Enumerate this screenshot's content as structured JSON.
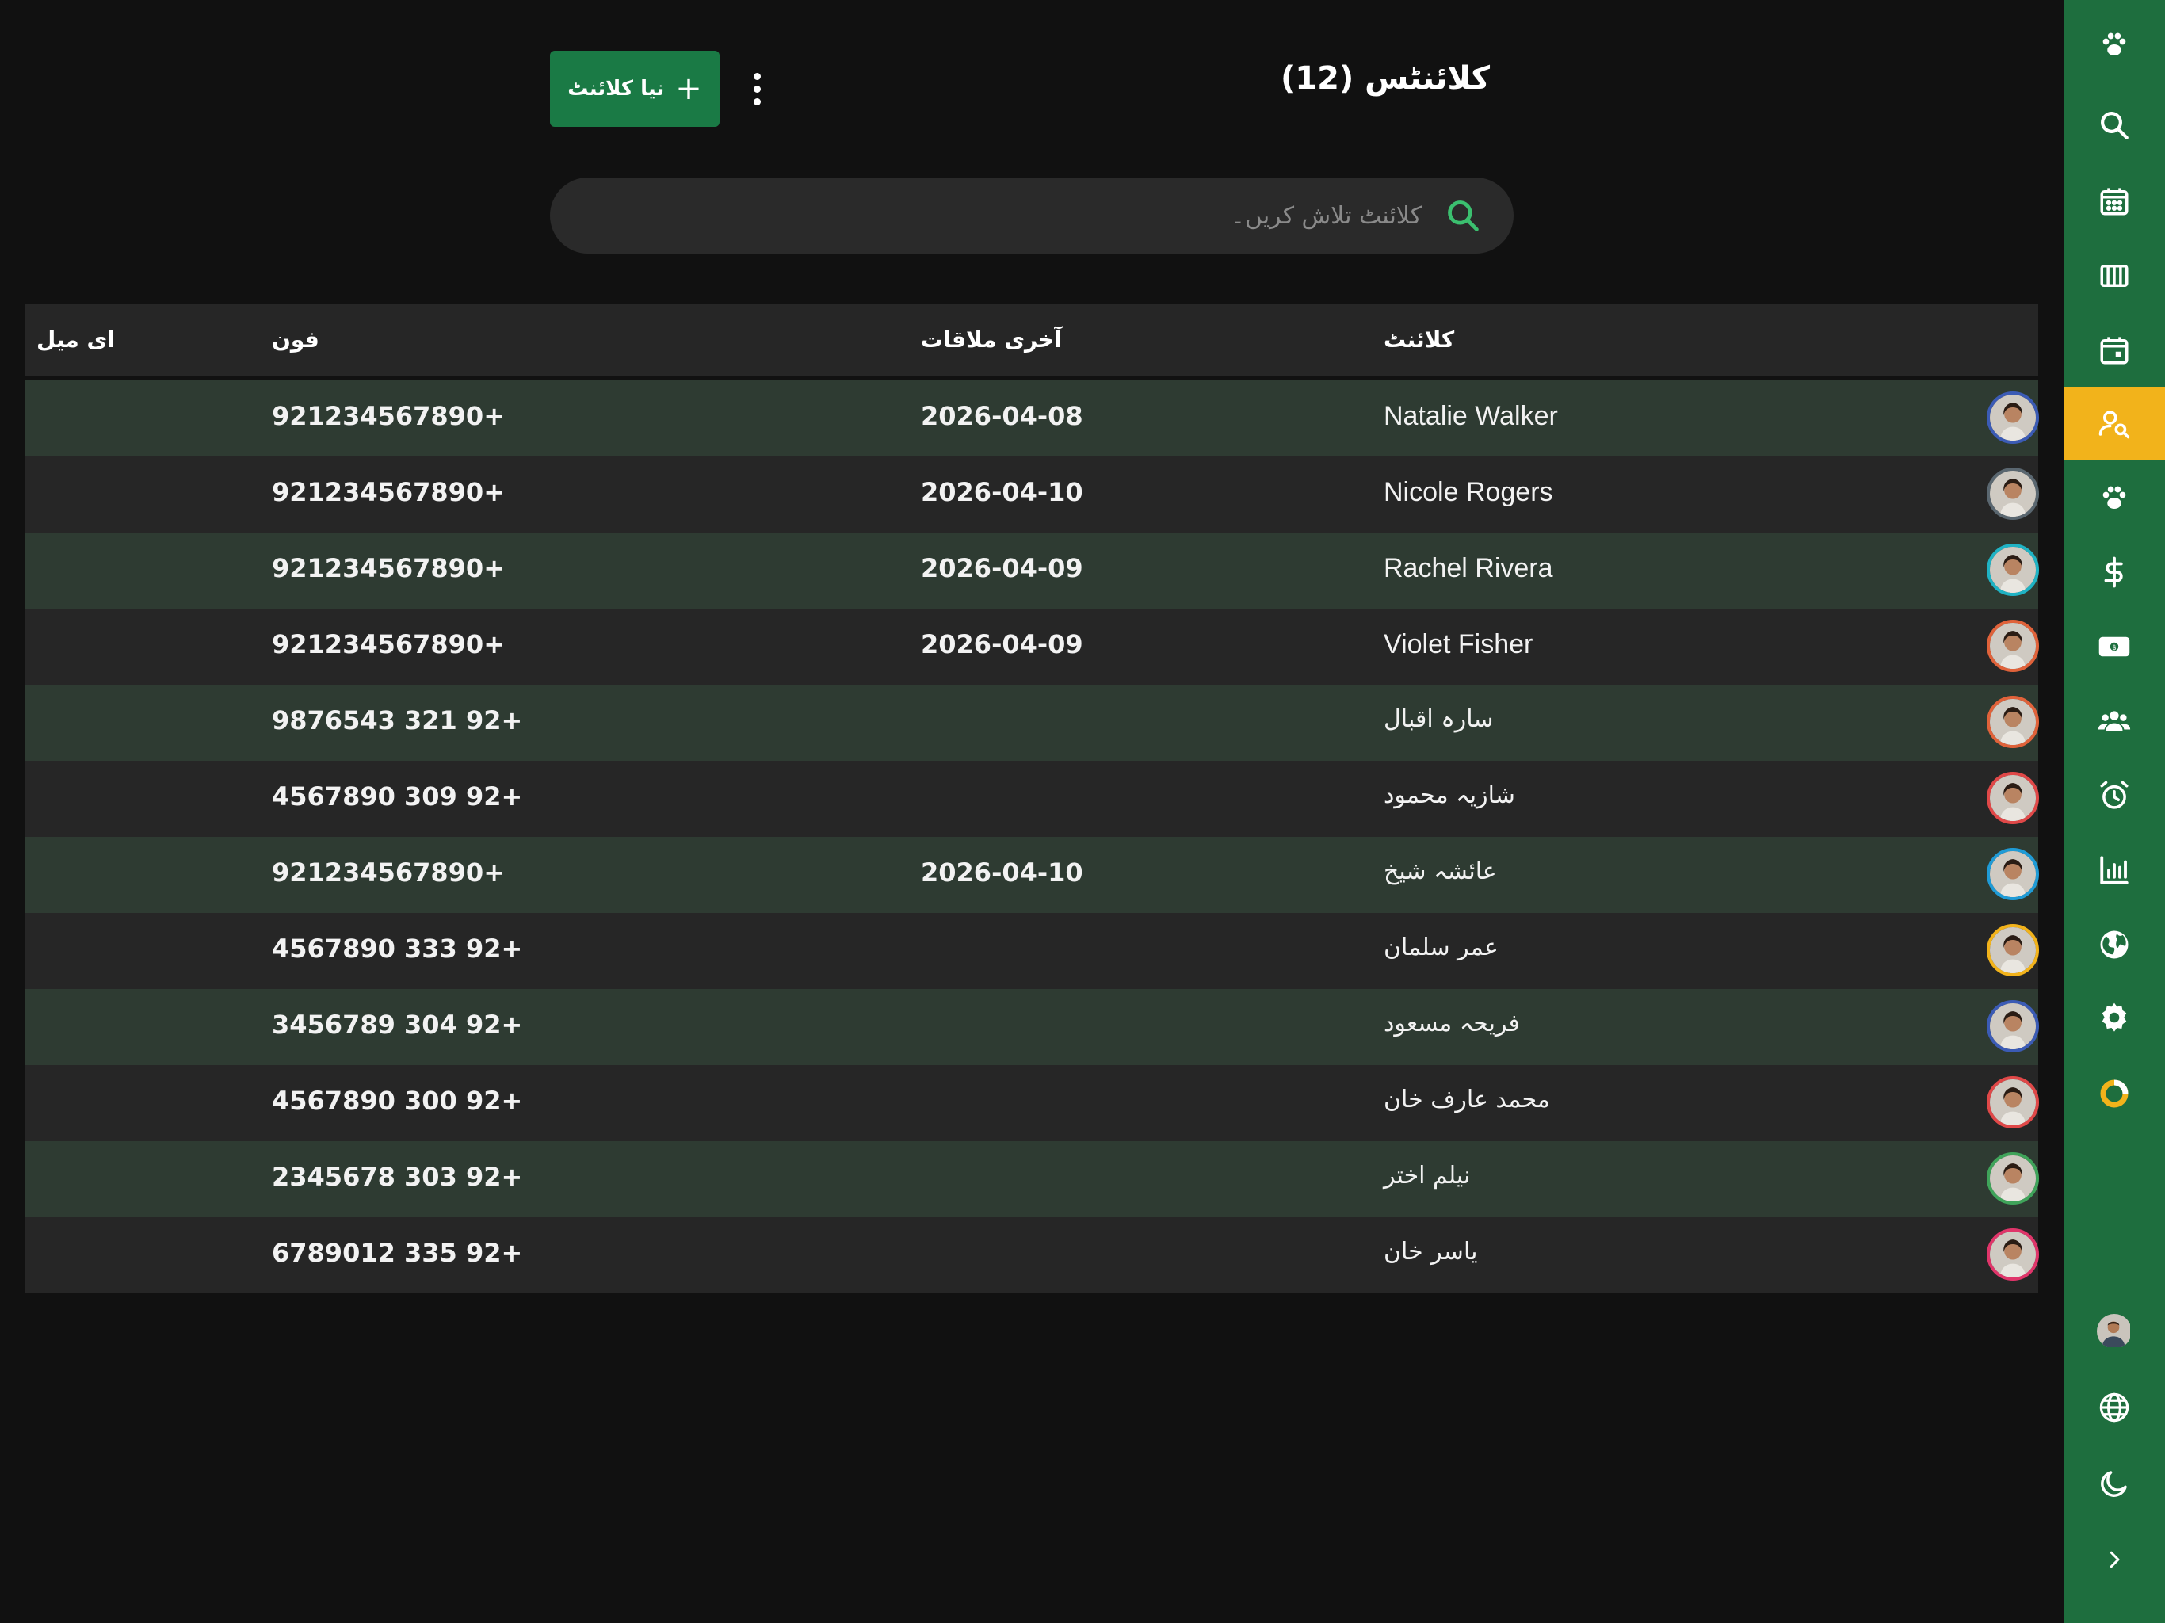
{
  "header": {
    "title": "کلائنٹس (12)",
    "add_button_label": "نیا کلائنٹ",
    "add_button_icon": "plus-icon",
    "more_icon": "kebab-menu-icon"
  },
  "search": {
    "placeholder": "کلائنٹ تلاش کریں۔",
    "value": "",
    "icon": "search-icon",
    "icon_color": "#3bbf6f"
  },
  "table": {
    "columns": {
      "client": "کلائنٹ",
      "last_visit": "آخری ملاقات",
      "phone": "فون",
      "email": "ای میل"
    },
    "rows": [
      {
        "name": "Natalie Walker",
        "last_visit": "2026-04-08",
        "phone": "921234567890+",
        "email": "",
        "avatar_ring": "#3b5bb5"
      },
      {
        "name": "Nicole Rogers",
        "last_visit": "2026-04-10",
        "phone": "921234567890+",
        "email": "",
        "avatar_ring": "#5a6770"
      },
      {
        "name": "Rachel Rivera",
        "last_visit": "2026-04-09",
        "phone": "921234567890+",
        "email": "",
        "avatar_ring": "#1fb3c4"
      },
      {
        "name": "Violet Fisher",
        "last_visit": "2026-04-09",
        "phone": "921234567890+",
        "email": "",
        "avatar_ring": "#e0623a"
      },
      {
        "name": "سارہ اقبال",
        "last_visit": "",
        "phone": "9876543 321 92+",
        "email": "",
        "avatar_ring": "#e0623a"
      },
      {
        "name": "شازیہ محمود",
        "last_visit": "",
        "phone": "4567890 309 92+",
        "email": "",
        "avatar_ring": "#e04848"
      },
      {
        "name": "عائشہ شیخ",
        "last_visit": "2026-04-10",
        "phone": "921234567890+",
        "email": "",
        "avatar_ring": "#1f9bd6"
      },
      {
        "name": "عمر سلمان",
        "last_visit": "",
        "phone": "4567890 333 92+",
        "email": "",
        "avatar_ring": "#f2b31b"
      },
      {
        "name": "فریحہ مسعود",
        "last_visit": "",
        "phone": "3456789 304 92+",
        "email": "",
        "avatar_ring": "#3b5bb5"
      },
      {
        "name": "محمد عارف خان",
        "last_visit": "",
        "phone": "4567890 300 92+",
        "email": "",
        "avatar_ring": "#e04848"
      },
      {
        "name": "نیلم اختر",
        "last_visit": "",
        "phone": "2345678 303 92+",
        "email": "",
        "avatar_ring": "#3fa45a"
      },
      {
        "name": "یاسر خان",
        "last_visit": "",
        "phone": "6789012 335 92+",
        "email": "",
        "avatar_ring": "#e0356a"
      }
    ]
  },
  "sidebar": {
    "active_color": "#f2b31b",
    "background": "#1e6e3e",
    "items": [
      {
        "icon": "paw-logo-icon"
      },
      {
        "icon": "search-icon"
      },
      {
        "icon": "calendar-grid-icon"
      },
      {
        "icon": "columns-icon"
      },
      {
        "icon": "calendar-day-icon"
      },
      {
        "icon": "client-search-icon",
        "active": true
      },
      {
        "icon": "paw-icon"
      },
      {
        "icon": "dollar-icon"
      },
      {
        "icon": "cash-icon"
      },
      {
        "icon": "users-icon"
      },
      {
        "icon": "alarm-icon"
      },
      {
        "icon": "bar-chart-icon"
      },
      {
        "icon": "globe-icon"
      },
      {
        "icon": "settings-icon"
      },
      {
        "icon": "progress-ring-icon"
      }
    ],
    "bottom": [
      {
        "icon": "user-avatar"
      },
      {
        "icon": "language-icon"
      },
      {
        "icon": "moon-icon"
      },
      {
        "icon": "chevron-right-icon"
      }
    ]
  }
}
